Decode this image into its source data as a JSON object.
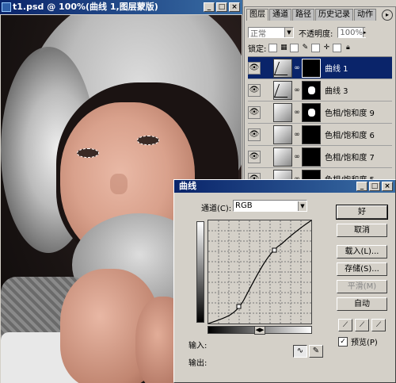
{
  "document": {
    "title": "t1.psd @ 100%(曲线 1,图层蒙版)",
    "window_buttons": [
      "_",
      "□",
      "×"
    ]
  },
  "layers_panel": {
    "tabs": [
      "图层",
      "通道",
      "路径",
      "历史记录",
      "动作"
    ],
    "active_tab": "图层",
    "menu_icon": "▸",
    "blend_mode": "正常",
    "opacity_label": "不透明度:",
    "opacity_value": "100%",
    "lock_label": "锁定:",
    "layers": [
      {
        "name": "曲线 1",
        "selected": true
      },
      {
        "name": "曲线 3",
        "selected": false
      },
      {
        "name": "色相/饱和度 9",
        "selected": false
      },
      {
        "name": "色相/饱和度 6",
        "selected": false
      },
      {
        "name": "色相/饱和度 7",
        "selected": false
      },
      {
        "name": "色相/饱和度 5",
        "selected": false
      }
    ]
  },
  "curves_dialog": {
    "title": "曲线",
    "channel_label": "通道(C):",
    "channel_value": "RGB",
    "input_label": "输入:",
    "output_label": "输出:",
    "buttons": {
      "ok": "好",
      "cancel": "取消",
      "load": "载入(L)...",
      "save": "存储(S)...",
      "smooth": "平滑(M)",
      "auto": "自动"
    },
    "preview_label": "预览(P)",
    "preview_checked": true
  },
  "colors": {
    "title_bar_start": "#0a246a",
    "title_bar_end": "#3a6ea5",
    "dialog_bg": "#d4d0c8",
    "selected_row": "#0a246a"
  }
}
